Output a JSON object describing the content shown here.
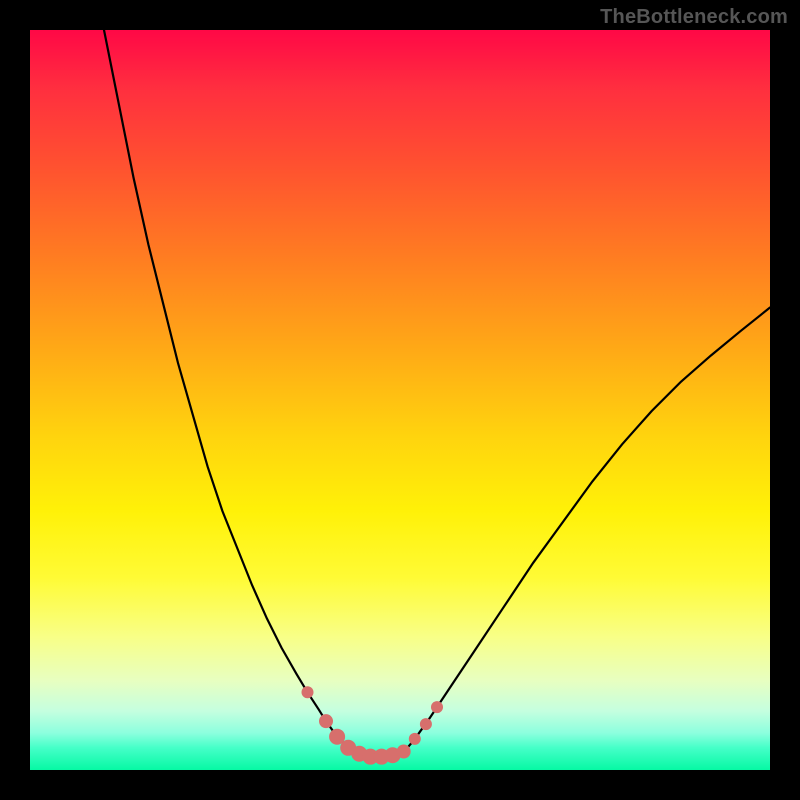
{
  "watermark": "TheBottleneck.com",
  "colors": {
    "marker": "#d76f6c",
    "curve": "#000000"
  },
  "chart_data": {
    "type": "line",
    "title": "",
    "xlabel": "",
    "ylabel": "",
    "xlim": [
      0,
      100
    ],
    "ylim": [
      0,
      100
    ],
    "grid": false,
    "curve_left": {
      "x": [
        10,
        12,
        14,
        16,
        18,
        20,
        22,
        24,
        26,
        28,
        30,
        32,
        34,
        36,
        37.5,
        39,
        40,
        41,
        42,
        43,
        44
      ],
      "y": [
        100,
        90,
        80,
        71,
        63,
        55,
        48,
        41,
        35,
        30,
        25,
        20.5,
        16.5,
        13,
        10.5,
        8.2,
        6.6,
        5.2,
        4,
        3,
        2.2
      ]
    },
    "curve_right": {
      "x": [
        50,
        51,
        52,
        53,
        54,
        55,
        57,
        60,
        64,
        68,
        72,
        76,
        80,
        84,
        88,
        92,
        96,
        100
      ],
      "y": [
        2.2,
        3,
        4.2,
        5.6,
        7,
        8.5,
        11.5,
        16,
        22,
        28,
        33.5,
        39,
        44,
        48.5,
        52.5,
        56,
        59.3,
        62.5
      ]
    },
    "markers": [
      {
        "x": 37.5,
        "y": 10.5,
        "r": 6
      },
      {
        "x": 40.0,
        "y": 6.6,
        "r": 7
      },
      {
        "x": 41.5,
        "y": 4.5,
        "r": 8
      },
      {
        "x": 43.0,
        "y": 3.0,
        "r": 8
      },
      {
        "x": 44.5,
        "y": 2.2,
        "r": 8
      },
      {
        "x": 46.0,
        "y": 1.8,
        "r": 8
      },
      {
        "x": 47.5,
        "y": 1.8,
        "r": 8
      },
      {
        "x": 49.0,
        "y": 2.0,
        "r": 8
      },
      {
        "x": 50.5,
        "y": 2.5,
        "r": 7
      },
      {
        "x": 52.0,
        "y": 4.2,
        "r": 6
      },
      {
        "x": 53.5,
        "y": 6.2,
        "r": 6
      },
      {
        "x": 55.0,
        "y": 8.5,
        "r": 6
      }
    ]
  }
}
